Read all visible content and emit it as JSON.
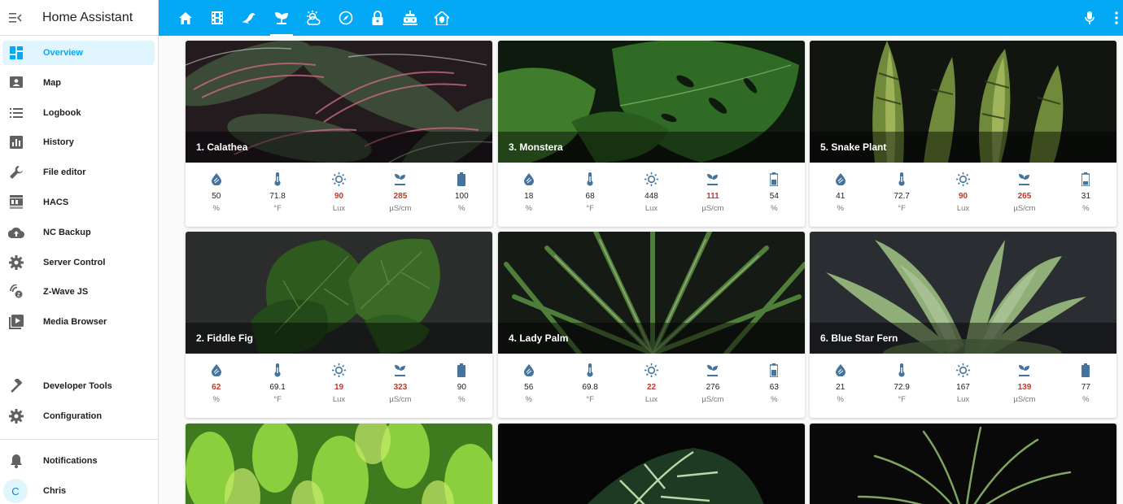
{
  "app": {
    "title": "Home Assistant"
  },
  "sidebar": {
    "items": [
      {
        "label": "Overview",
        "icon": "dashboard-icon",
        "active": true
      },
      {
        "label": "Map",
        "icon": "map-icon"
      },
      {
        "label": "Logbook",
        "icon": "logbook-icon"
      },
      {
        "label": "History",
        "icon": "history-chart-icon"
      },
      {
        "label": "File editor",
        "icon": "wrench-icon"
      },
      {
        "label": "HACS",
        "icon": "hacs-icon"
      },
      {
        "label": "NC Backup",
        "icon": "cloud-upload-icon"
      },
      {
        "label": "Server Control",
        "icon": "cog-icon"
      },
      {
        "label": "Z-Wave JS",
        "icon": "zwave-icon"
      },
      {
        "label": "Media Browser",
        "icon": "media-play-icon"
      }
    ],
    "tools": [
      {
        "label": "Developer Tools",
        "icon": "hammer-icon"
      },
      {
        "label": "Configuration",
        "icon": "cog-icon"
      }
    ],
    "notifications": {
      "label": "Notifications",
      "icon": "bell-icon"
    },
    "user": {
      "initial": "C",
      "name": "Chris"
    }
  },
  "topbar": {
    "tabs": [
      "home-icon",
      "film-icon",
      "bird-icon",
      "sprout-icon",
      "weather-icon",
      "compass-icon",
      "lock-icon",
      "robot-vacuum-icon",
      "house-shield-icon"
    ],
    "active_tab": 3,
    "actions": [
      "microphone-icon",
      "more-vert-icon"
    ]
  },
  "colors": {
    "primary": "#03a9f4",
    "icon": "#44739e",
    "warning": "#c0392b",
    "active_bg": "#e1f5fe"
  },
  "plants": [
    {
      "name": "1. Calathea",
      "sensors": [
        {
          "value": "50",
          "unit": "%",
          "warn": false
        },
        {
          "value": "71.8",
          "unit": "°F",
          "warn": false
        },
        {
          "value": "90",
          "unit": "Lux",
          "warn": true
        },
        {
          "value": "285",
          "unit": "µS/cm",
          "warn": true
        },
        {
          "value": "100",
          "unit": "%",
          "warn": false
        }
      ]
    },
    {
      "name": "3. Monstera",
      "sensors": [
        {
          "value": "18",
          "unit": "%",
          "warn": false
        },
        {
          "value": "68",
          "unit": "°F",
          "warn": false
        },
        {
          "value": "448",
          "unit": "Lux",
          "warn": false
        },
        {
          "value": "111",
          "unit": "µS/cm",
          "warn": true
        },
        {
          "value": "54",
          "unit": "%",
          "warn": false
        }
      ]
    },
    {
      "name": "5. Snake Plant",
      "sensors": [
        {
          "value": "41",
          "unit": "%",
          "warn": false
        },
        {
          "value": "72.7",
          "unit": "°F",
          "warn": false
        },
        {
          "value": "90",
          "unit": "Lux",
          "warn": true
        },
        {
          "value": "265",
          "unit": "µS/cm",
          "warn": true
        },
        {
          "value": "31",
          "unit": "%",
          "warn": false
        }
      ]
    },
    {
      "name": "2. Fiddle Fig",
      "sensors": [
        {
          "value": "62",
          "unit": "%",
          "warn": true
        },
        {
          "value": "69.1",
          "unit": "°F",
          "warn": false
        },
        {
          "value": "19",
          "unit": "Lux",
          "warn": true
        },
        {
          "value": "323",
          "unit": "µS/cm",
          "warn": true
        },
        {
          "value": "90",
          "unit": "%",
          "warn": false
        }
      ]
    },
    {
      "name": "4. Lady Palm",
      "sensors": [
        {
          "value": "56",
          "unit": "%",
          "warn": false
        },
        {
          "value": "69.8",
          "unit": "°F",
          "warn": false
        },
        {
          "value": "22",
          "unit": "Lux",
          "warn": true
        },
        {
          "value": "276",
          "unit": "µS/cm",
          "warn": false
        },
        {
          "value": "63",
          "unit": "%",
          "warn": false
        }
      ]
    },
    {
      "name": "6. Blue Star Fern",
      "sensors": [
        {
          "value": "21",
          "unit": "%",
          "warn": false
        },
        {
          "value": "72.9",
          "unit": "°F",
          "warn": false
        },
        {
          "value": "167",
          "unit": "Lux",
          "warn": false
        },
        {
          "value": "139",
          "unit": "µS/cm",
          "warn": true
        },
        {
          "value": "77",
          "unit": "%",
          "warn": false
        }
      ]
    }
  ],
  "sensor_icons": [
    "water-drop-icon",
    "thermometer-icon",
    "sun-icon",
    "sprout-icon",
    "battery-icon"
  ]
}
